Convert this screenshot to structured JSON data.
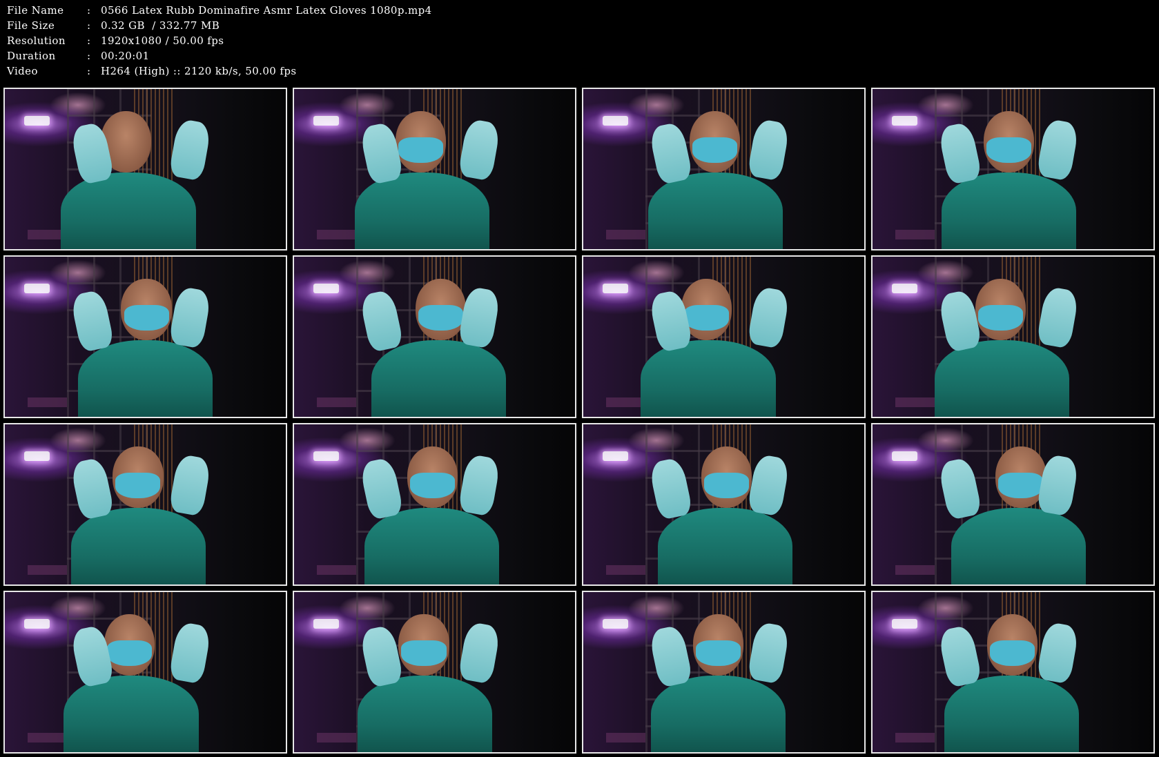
{
  "info": {
    "rows": [
      {
        "key": "File Name",
        "sep": ":",
        "value": "0566 Latex Rubb Dominafire Asmr Latex Gloves 1080p.mp4"
      },
      {
        "key": "File Size",
        "sep": ":",
        "value": "0.32 GB  / 332.77 MB"
      },
      {
        "key": "Resolution",
        "sep": ":",
        "value": "1920x1080 / 50.00 fps"
      },
      {
        "key": "Duration",
        "sep": ":",
        "value": "00:20:01"
      },
      {
        "key": "Video",
        "sep": ":",
        "value": "H264 (High) :: 2120 kb/s, 50.00 fps"
      }
    ]
  },
  "thumbnails": {
    "count": 16,
    "columns": 4,
    "rows": 4,
    "border_color": "#e8e8e8",
    "scrub_color": "#1f8a7f",
    "mask_color": "#4cb8d0",
    "glove_color": "#9fd8dc",
    "accent_light_color": "#d28cff"
  }
}
